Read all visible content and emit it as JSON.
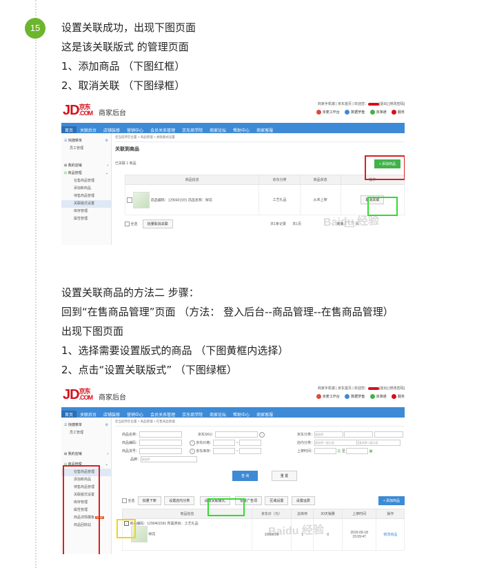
{
  "step_number": "15",
  "intro_lines": [
    "设置关联成功，出现下图页面",
    "这是该关联版式 的管理页面",
    "1、添加商品 （下图红框）",
    "2、取消关联 （下图绿框）"
  ],
  "method_lines": [
    "设置关联商品的方法二  步骤：",
    "回到“在售商品管理”页面 （方法： 登入后台--商品管理--在售商品管理）",
    "出现下图页面",
    "1、选择需要设置版式的商品 （下图黄框内选择）",
    "2、点击“设置关联版式” （下图绿框）"
  ],
  "shot_common": {
    "logo_jd": "JD",
    "logo_cn": "京东",
    "logo_com": ".COM",
    "backend": "商家后台",
    "top_account": "商家手机端 | 京东首页 | 欢迎您：",
    "top_exit": "[退出] [修改密码]",
    "top_links": [
      "京麦工作台",
      "数据罗盘",
      "京准通",
      "服务"
    ],
    "nav": [
      "首页",
      "关联后台",
      "店铺装修",
      "营销中心",
      "会员关系管理",
      "京东商学院",
      "商家论坛",
      "帮助中心",
      "商家客服"
    ],
    "quick_menu": "快捷菜单",
    "staff": "员工管理",
    "my_shop": "我的店铺",
    "goods_mgmt": "商品管理",
    "watermark": "Baidu 经验"
  },
  "shot1": {
    "sidebar_subs": [
      "在售商品管理",
      "添加新商品",
      "待售商品管理",
      "关联版式设置",
      "库存管理",
      "属性管理"
    ],
    "breadcrumb": "您当前所在位置 > 商品管理 > 关联版式设置",
    "title": "关联到商品",
    "count_label": "已关联 1 商品",
    "add_button": "+ 添加商品",
    "columns": [
      "商品信息",
      "京东分类",
      "商品状态",
      "操作"
    ],
    "row": {
      "sku": "商品编码：1290401591",
      "name": "商品名称：鲜花",
      "category": "工艺礼品",
      "status": "从未上架",
      "action": "取消关联"
    },
    "select_all": "全选",
    "batch_cancel": "批量取消关联",
    "pager_total": "共1条记录",
    "pager_page": "共1页",
    "pager_jump": "到第",
    "pager_page_suffix": "页"
  },
  "shot2": {
    "sidebar_subs": [
      "在售商品管理",
      "添加新商品",
      "待售商品管理",
      "关联版式设置",
      "库存管理",
      "属性管理",
      "商品详情模板",
      "商品回收站"
    ],
    "new_badge": "NEW",
    "breadcrumb": "您当前所在位置 > 商品管理 > 在售商品管理",
    "f_name": "商品名称：",
    "f_code": "商品编码：",
    "f_no": "商品货号：",
    "f_brand": "品牌：",
    "f_brand_ph": "请选择",
    "f_sku": "京东SKU：",
    "f_price": "京东价格：",
    "f_stock": "京东库存：",
    "f_jdcat": "京东分类：",
    "f_jdcat_ph": "请选择",
    "f_shopcat": "店内分类：",
    "f_shopcat_ph": "请选择一级分类",
    "f_shopcat2_ph": "请选择二级分类",
    "f_time": "上架时间：",
    "f_to": "至",
    "search_btn": "查 询",
    "reset_btn": "重 置",
    "toolbar": [
      "全选",
      "批量下架",
      "设置店内分类",
      "设置关联版式",
      "设置广告词",
      "区域设置",
      "设置运费"
    ],
    "add_btn": "+ 添加商品",
    "columns": [
      "商品信息",
      "京东价（元）",
      "总库存",
      "30天销量",
      "上架时间",
      "操作"
    ],
    "row": {
      "sku": "商品编码：1290401591",
      "cat": "所属类目：工艺礼品",
      "name": "鲜花",
      "price": "10000.00",
      "stock": "1",
      "sales": "0",
      "date": "2015-09-18",
      "time": "15:09:47",
      "action": "修改商品"
    }
  },
  "colors": {
    "badge": "#6cb52d",
    "nav": "#3d8ad6",
    "red_box": "#d91e1e",
    "green_box": "#2fdc2f",
    "yellow_box": "#f4d21a"
  }
}
